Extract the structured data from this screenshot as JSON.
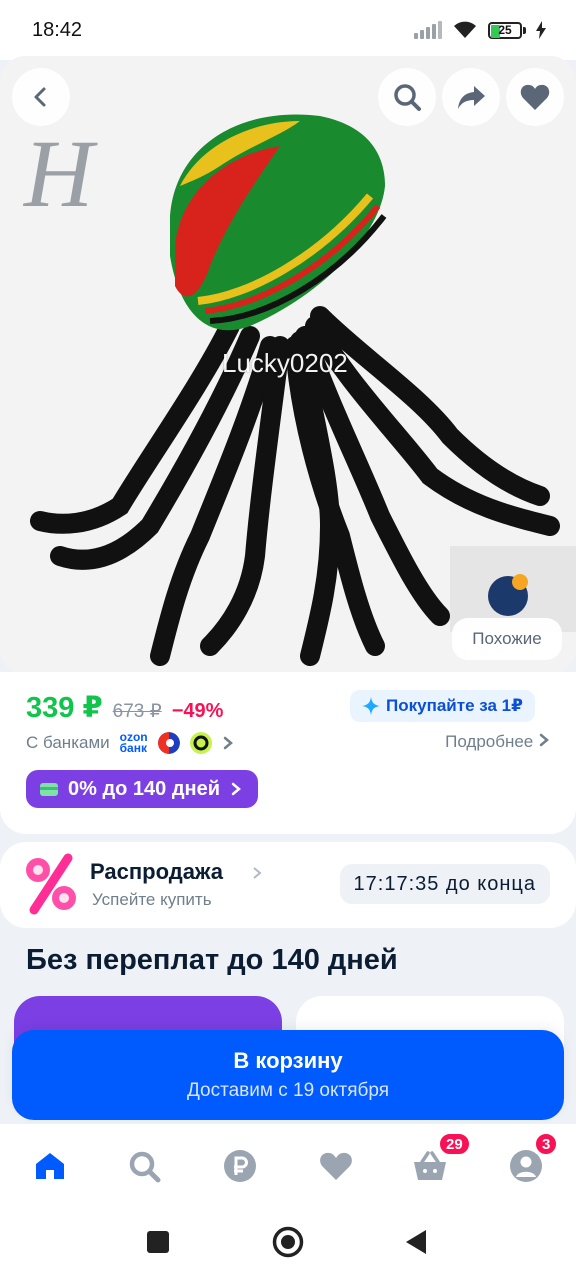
{
  "status_bar": {
    "time": "18:42",
    "battery_level": "25"
  },
  "product": {
    "watermark": "Lucky0202",
    "seller_logo_letter": "H",
    "similar_label": "Похожие"
  },
  "price": {
    "current": "339 ₽",
    "old": "673 ₽",
    "discount": "−49%",
    "buy_for_label": "Покупайте за 1₽",
    "bank_label": "С банками",
    "ozon_bank_line1": "ozon",
    "ozon_bank_line2": "банк",
    "details_label": "Подробнее",
    "credit_label": "0% до 140 дней"
  },
  "sale": {
    "title": "Распродажа",
    "subtitle": "Успейте купить",
    "timer": "17:17:35 до конца"
  },
  "installment_section": {
    "title": "Без переплат до 140 дней"
  },
  "cart_button": {
    "title": "В корзину",
    "subtitle": "Доставим с 19 октября"
  },
  "bottom_nav": {
    "cart_badge": "29",
    "profile_badge": "3"
  },
  "colors": {
    "brand_blue": "#005bff",
    "price_green": "#10c44c",
    "discount_red": "#f91155",
    "credit_purple": "#7b3fe4"
  }
}
